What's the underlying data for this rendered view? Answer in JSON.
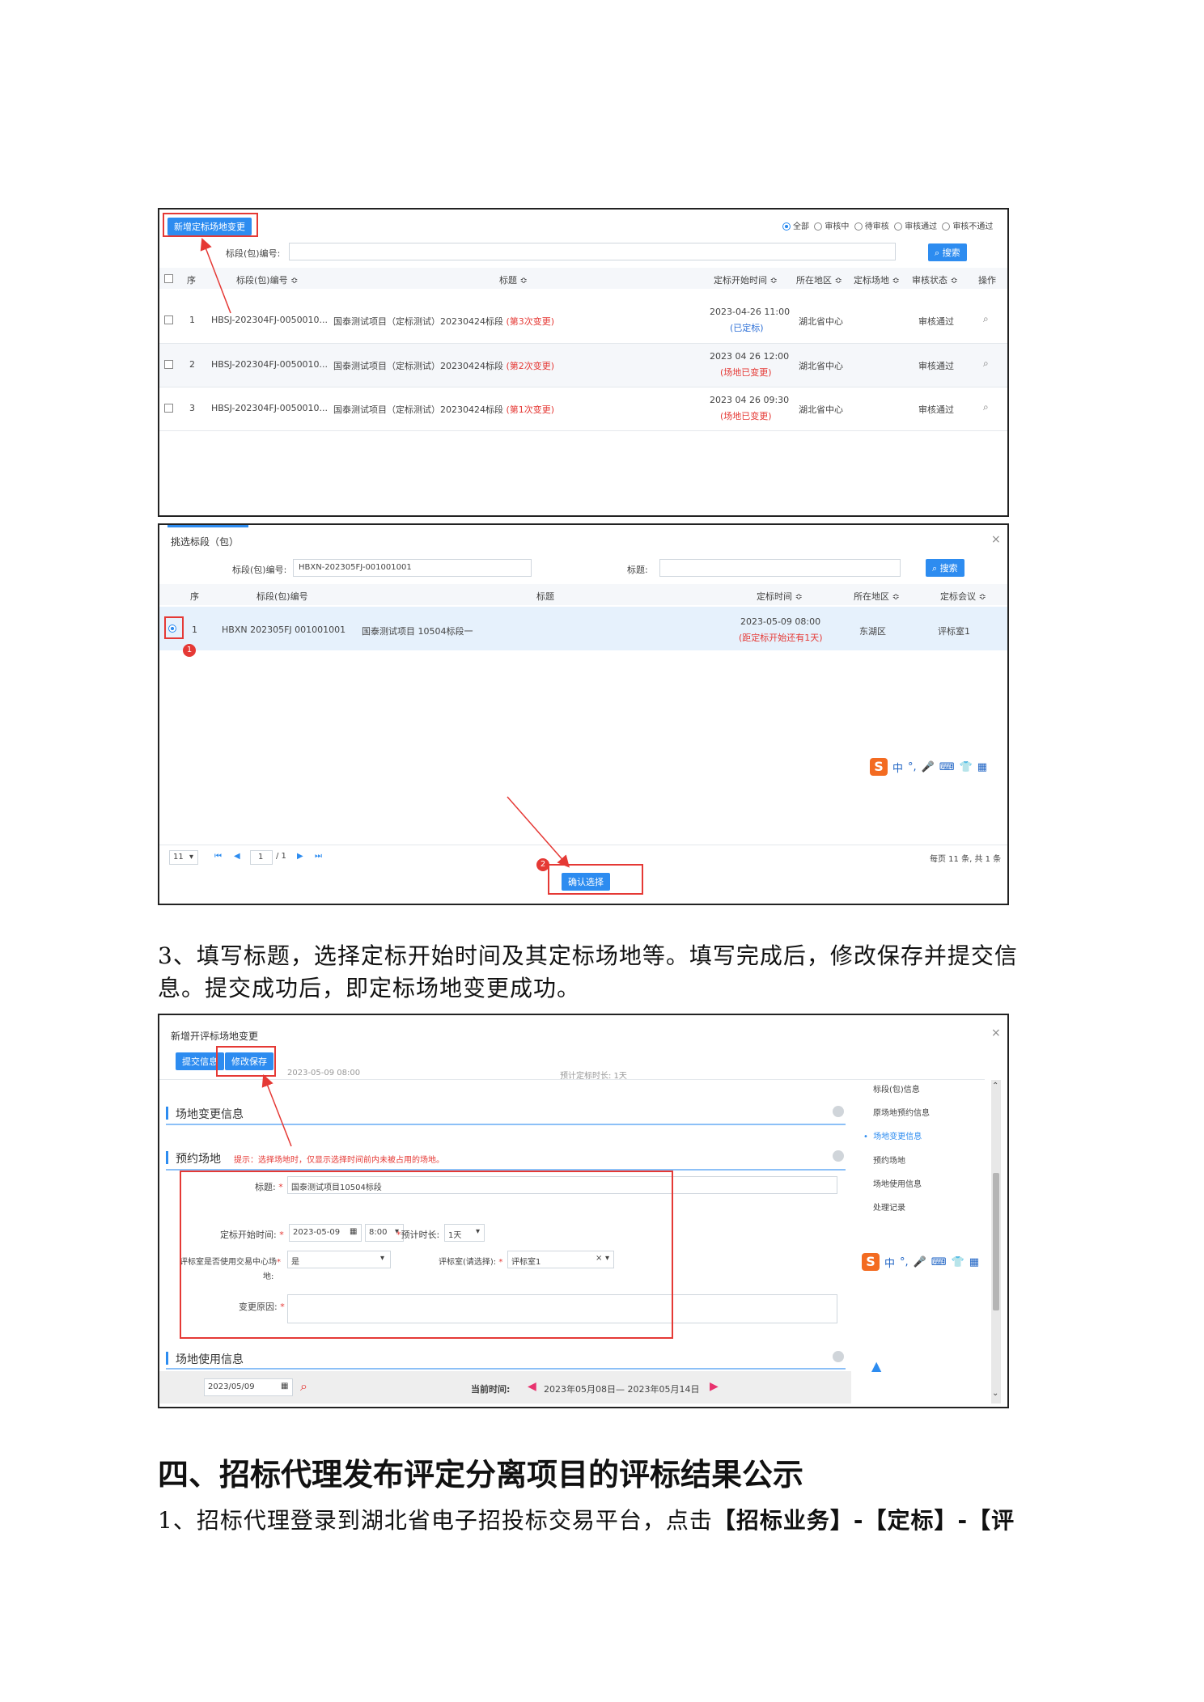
{
  "shot1": {
    "add_button": "新增定标场地变更",
    "filters": [
      "全部",
      "审核中",
      "待审核",
      "审核通过",
      "审核不通过"
    ],
    "search_label": "标段(包)编号:",
    "search_button": "搜索",
    "columns": [
      "序",
      "标段(包)编号 ≎",
      "标题 ≎",
      "定标开始时间 ≎",
      "所在地区 ≎",
      "定标场地 ≎",
      "审核状态 ≎",
      "操作"
    ],
    "rows": [
      {
        "no": "1",
        "code": "HBSJ-202304FJ-0050010...",
        "title": "国泰测试项目（定标测试）20230424标段",
        "change": "(第3次变更)",
        "time": "2023-04-26 11:00",
        "time_note": "(已定标)",
        "area": "湖北省中心",
        "status": "审核通过"
      },
      {
        "no": "2",
        "code": "HBSJ-202304FJ-0050010...",
        "title": "国泰测试项目（定标测试）20230424标段",
        "change": "(第2次变更)",
        "time": "2023 04 26 12:00",
        "time_note": "(场地已变更)",
        "area": "湖北省中心",
        "status": "审核通过"
      },
      {
        "no": "3",
        "code": "HBSJ-202304FJ-0050010...",
        "title": "国泰测试项目（定标测试）20230424标段",
        "change": "(第1次变更)",
        "time": "2023 04 26 09:30",
        "time_note": "(场地已变更)",
        "area": "湖北省中心",
        "status": "审核通过"
      }
    ]
  },
  "shot2": {
    "title": "挑选标段（包）",
    "close": "×",
    "code_label": "标段(包)编号:",
    "code_value": "HBXN-202305FJ-001001001",
    "title_label": "标题:",
    "search_button": "搜索",
    "columns": [
      "序",
      "标段(包)编号",
      "标题",
      "定标时间 ≎",
      "所在地区 ≎",
      "定标会议 ≎"
    ],
    "row": {
      "no": "1",
      "code": "HBXN 202305FJ 001001001",
      "title": "国泰测试项目 10504标段一",
      "time": "2023-05-09 08:00",
      "time_note": "(距定标开始还有1天)",
      "area": "东湖区",
      "room": "评标室1"
    },
    "badge1": "1",
    "badge2": "2",
    "page_size": "11",
    "page_current": "1",
    "page_total": "/ 1",
    "page_info": "每页 11 条, 共 1 条",
    "confirm_button": "确认选择",
    "ime_label": "中"
  },
  "para1_line1": "3、填写标题，选择定标开始时间及其定标场地等。填写完成后，修改保存并提交信",
  "para1_line2": "息。提交成功后，即定标场地变更成功。",
  "shot3": {
    "title": "新增开评标场地变更",
    "close": "×",
    "submit_button": "提交信息",
    "save_button": "修改保存",
    "peek_text_1": "2023-05-09 08:00",
    "peek_text_2": "预计定标时长:   1天",
    "section_change": "场地变更信息",
    "section_booking": "预约场地",
    "booking_hint": "提示：选择场地时，仅显示选择时间前内未被占用的场地。",
    "field_title": "标题:",
    "title_value": "国泰测试项目10504标段",
    "field_start": "定标开始时间:",
    "start_date": "2023-05-09",
    "start_time": "8:00",
    "field_duration": "预计时长:",
    "duration_value": "1天",
    "field_use_center_1": "评标室是否使用交易中心场",
    "field_use_center_2": "地:",
    "use_center_value": "是",
    "field_room": "评标室(请选择):",
    "room_value": "评标室1",
    "field_reason": "变更原因:",
    "section_usage": "场地使用信息",
    "date_value": "2023/05/09",
    "current_time_label": "当前时间:",
    "current_range": "2023年05月08日— 2023年05月14日",
    "side_nav": [
      "标段(包)信息",
      "原场地预约信息",
      "场地变更信息",
      "预约场地",
      "场地使用信息",
      "处理记录"
    ],
    "ime_label": "中"
  },
  "heading4": "四、招标代理发布评定分离项目的评标结果公示",
  "para2_pre": "1、招标代理登录到湖北省电子招投标交易平台，点击",
  "para2_bold": "【招标业务】-【定标】-【评"
}
